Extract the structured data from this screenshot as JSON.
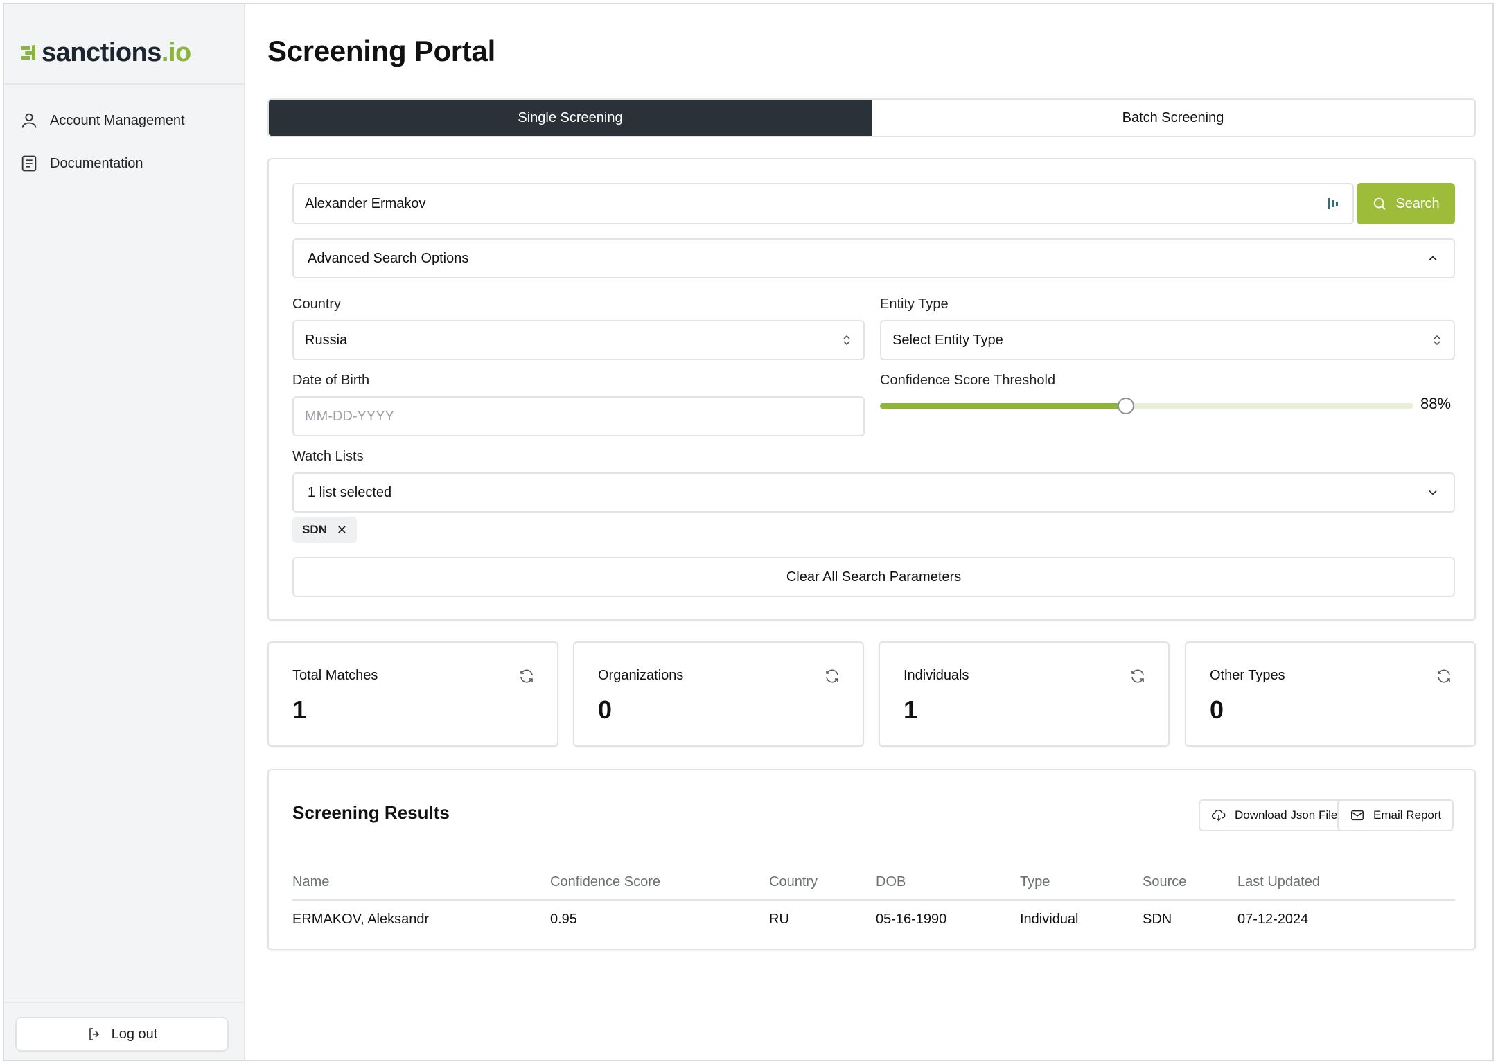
{
  "brand": {
    "name": "sanctions",
    "tld": ".io",
    "accent": "#8bb43c"
  },
  "sidebar": {
    "items": [
      {
        "label": "Account Management",
        "icon": "user-icon"
      },
      {
        "label": "Documentation",
        "icon": "document-icon"
      }
    ],
    "logout_label": "Log out"
  },
  "page": {
    "title": "Screening Portal"
  },
  "tabs": [
    {
      "label": "Single Screening",
      "active": true
    },
    {
      "label": "Batch Screening",
      "active": false
    }
  ],
  "search": {
    "value": "Alexander Ermakov",
    "button_label": "Search",
    "advanced_label": "Advanced Search Options"
  },
  "filters": {
    "country_label": "Country",
    "country_value": "Russia",
    "entity_type_label": "Entity Type",
    "entity_type_value": "Select Entity Type",
    "dob_label": "Date of Birth",
    "dob_placeholder": "MM-DD-YYYY",
    "confidence_label": "Confidence Score Threshold",
    "confidence_value": 88,
    "confidence_display": "88%",
    "watchlists_label": "Watch Lists",
    "watchlists_value": "1 list selected",
    "watchlist_chips": [
      "SDN"
    ],
    "clear_label": "Clear All Search Parameters"
  },
  "stats": [
    {
      "title": "Total Matches",
      "value": "1"
    },
    {
      "title": "Organizations",
      "value": "0"
    },
    {
      "title": "Individuals",
      "value": "1"
    },
    {
      "title": "Other Types",
      "value": "0"
    }
  ],
  "results": {
    "title": "Screening Results",
    "download_label": "Download Json File",
    "email_label": "Email Report",
    "columns": [
      "Name",
      "Confidence Score",
      "Country",
      "DOB",
      "Type",
      "Source",
      "Last Updated"
    ],
    "rows": [
      [
        "ERMAKOV, Aleksandr",
        "0.95",
        "RU",
        "05-16-1990",
        "Individual",
        "SDN",
        "07-12-2024"
      ]
    ]
  }
}
